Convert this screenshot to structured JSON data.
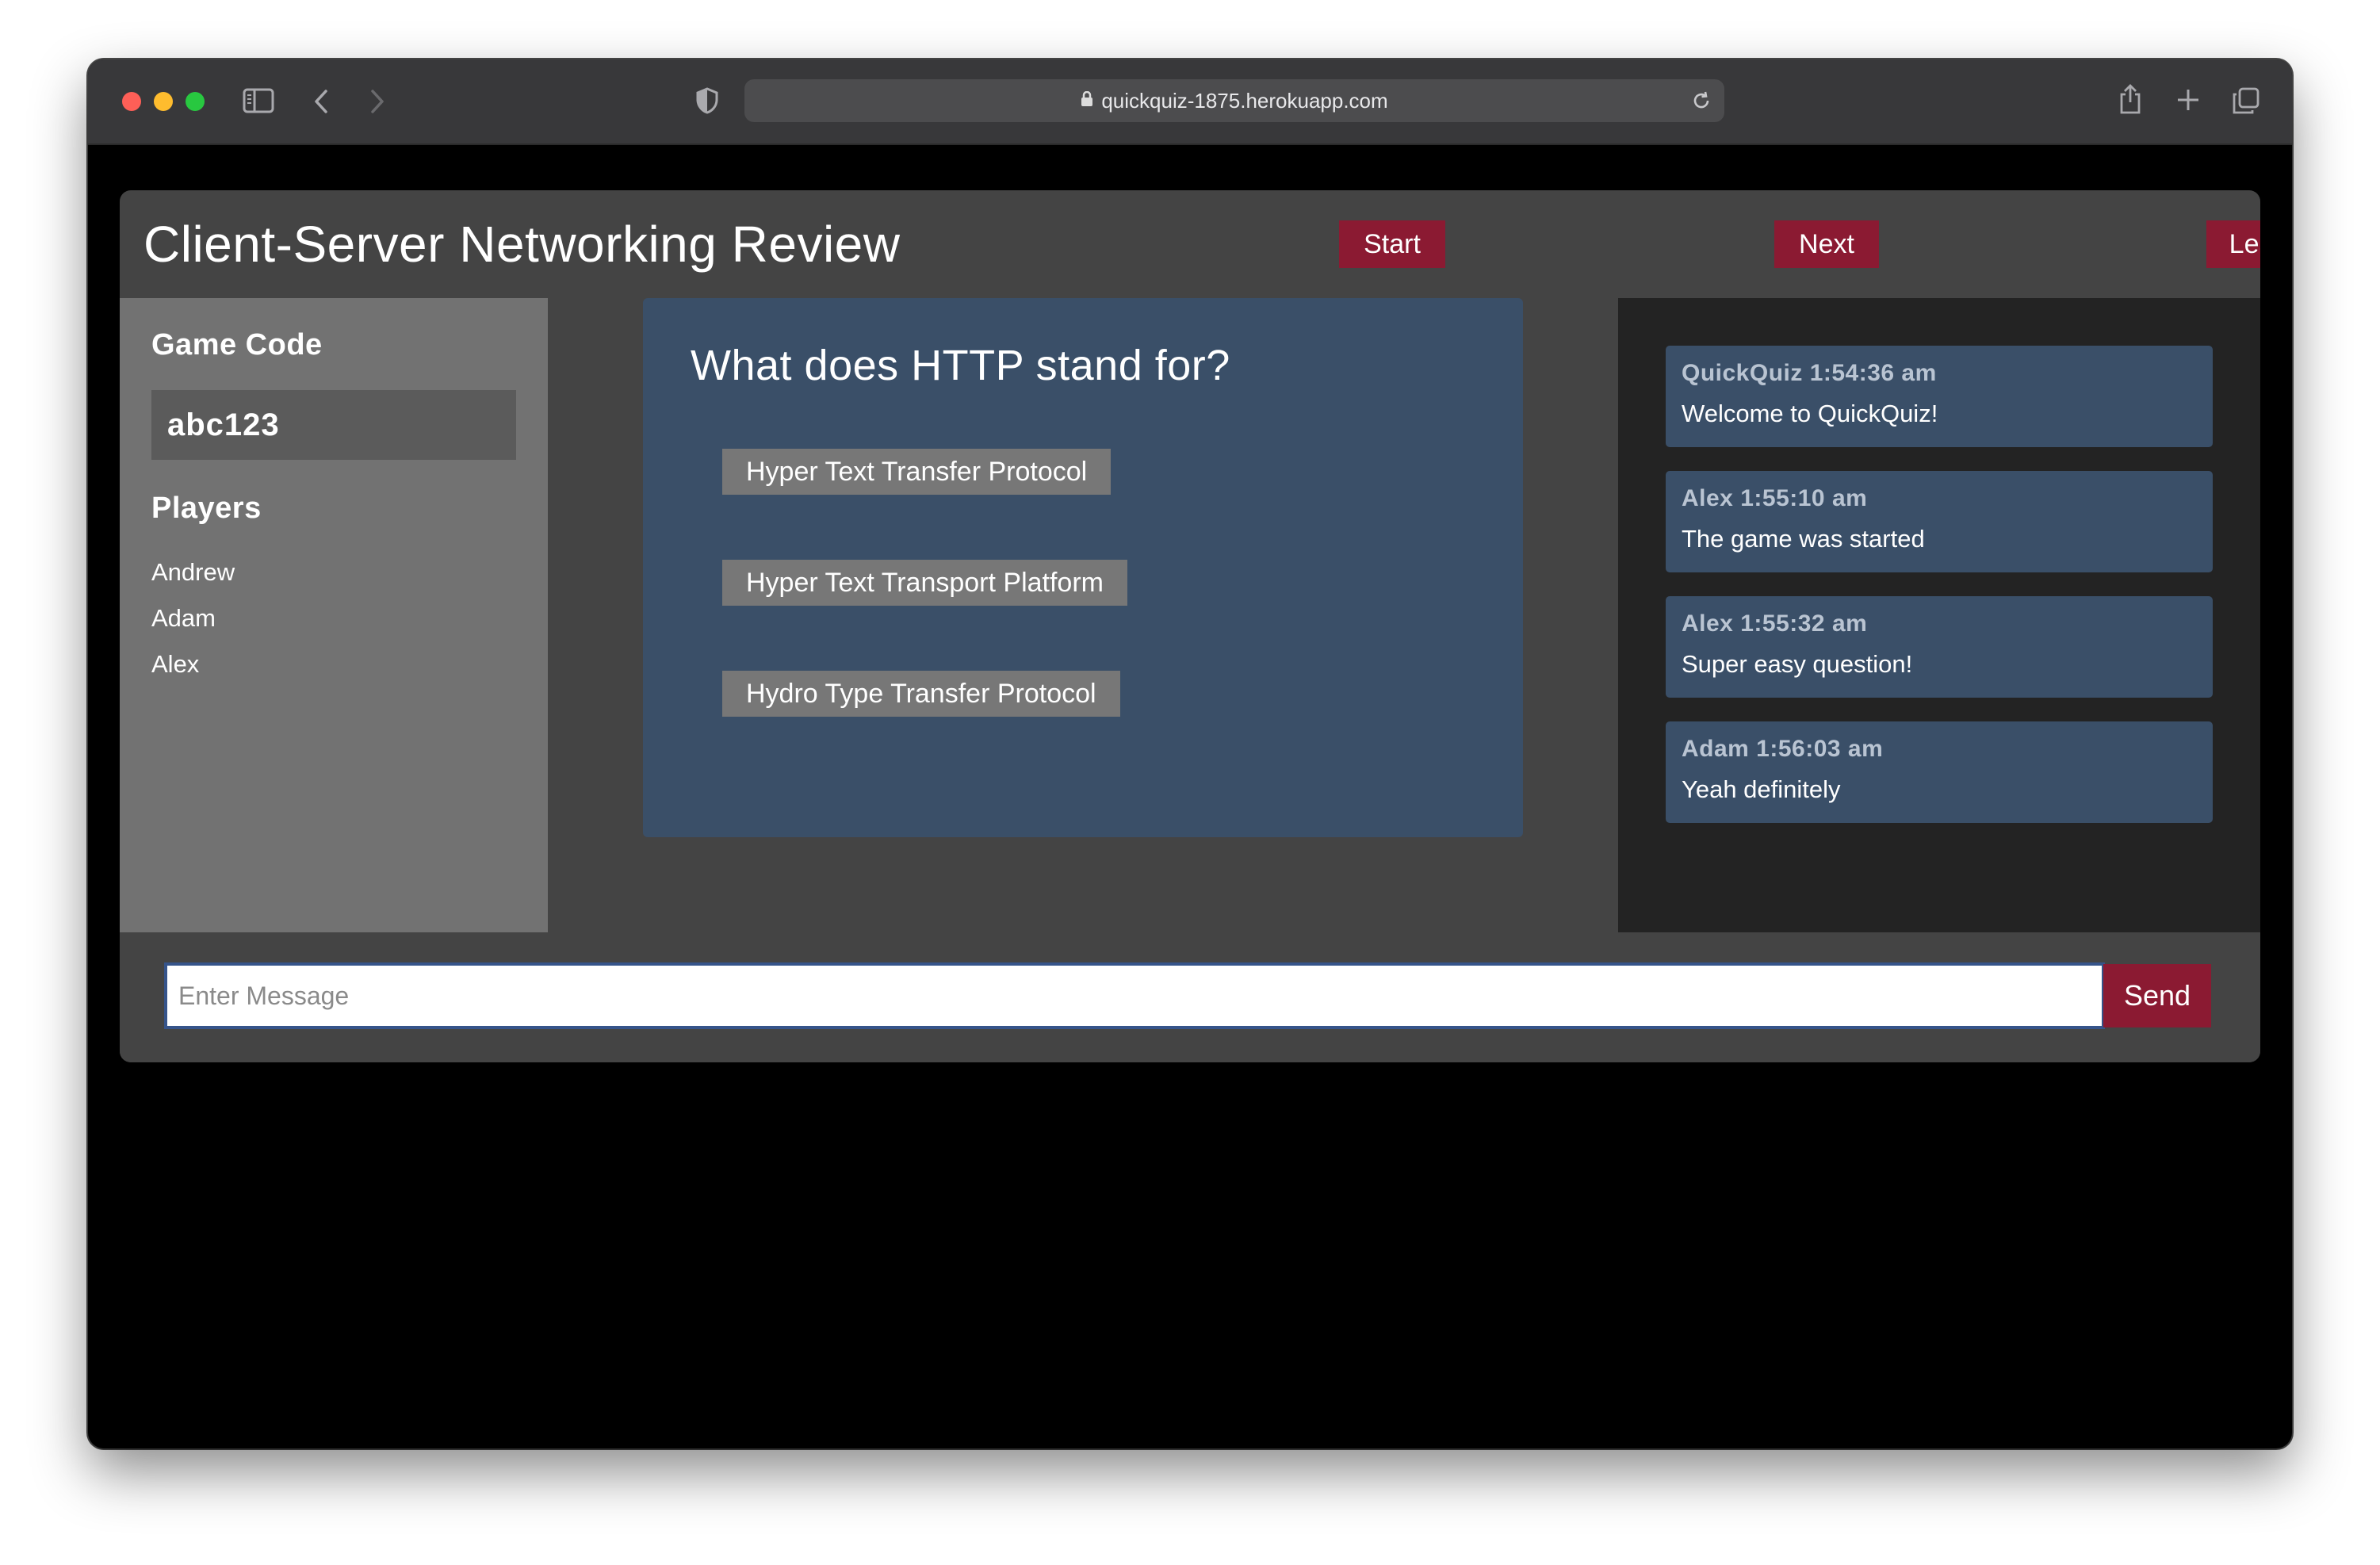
{
  "browser": {
    "url": "quickquiz-1875.herokuapp.com"
  },
  "header": {
    "title": "Client-Server Networking Review",
    "start_label": "Start",
    "next_label": "Next",
    "leave_label": "Leave"
  },
  "sidebar": {
    "game_code_label": "Game Code",
    "game_code": "abc123",
    "players_label": "Players",
    "players": [
      "Andrew",
      "Adam",
      "Alex"
    ]
  },
  "question": {
    "text": "What does HTTP stand for?",
    "answers": [
      "Hyper Text Transfer Protocol",
      "Hyper Text Transport Platform",
      "Hydro Type Transfer Protocol"
    ]
  },
  "chat": {
    "messages": [
      {
        "meta": "QuickQuiz 1:54:36 am",
        "text": "Welcome to QuickQuiz!"
      },
      {
        "meta": "Alex 1:55:10 am",
        "text": "The game was started"
      },
      {
        "meta": "Alex 1:55:32 am",
        "text": "Super easy question!"
      },
      {
        "meta": "Adam 1:56:03 am",
        "text": "Yeah definitely"
      }
    ],
    "input_placeholder": "Enter Message",
    "input_value": "",
    "send_label": "Send"
  },
  "colors": {
    "accent": "#8b1a32",
    "card": "#3a4f68",
    "focus_border": "#36548a"
  }
}
